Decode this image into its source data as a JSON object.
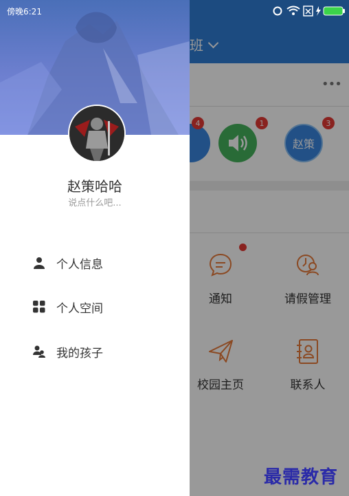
{
  "status_bar": {
    "time": "傍晚6:21"
  },
  "app": {
    "title": "班",
    "more_label": "•••",
    "icon_badges": [
      "4",
      "1",
      "3"
    ],
    "avatar_text": "赵策",
    "grid": [
      {
        "label": "通知",
        "icon": "chat-bubble-icon"
      },
      {
        "label": "请假管理",
        "icon": "leave-clock-icon"
      },
      {
        "label": "校园主页",
        "icon": "paper-plane-icon"
      },
      {
        "label": "联系人",
        "icon": "contact-book-icon"
      }
    ]
  },
  "drawer": {
    "user_name": "赵策哈哈",
    "signature": "说点什么吧...",
    "menu": [
      {
        "label": "个人信息",
        "icon": "person-icon"
      },
      {
        "label": "个人空间",
        "icon": "grid-icon"
      },
      {
        "label": "我的孩子",
        "icon": "children-icon"
      }
    ]
  },
  "watermark": "最需教育",
  "colors": {
    "header_blue": "#2f7ed6",
    "green": "#45b35d",
    "orange_icon": "#e87a3a",
    "badge_red": "#e53935"
  }
}
